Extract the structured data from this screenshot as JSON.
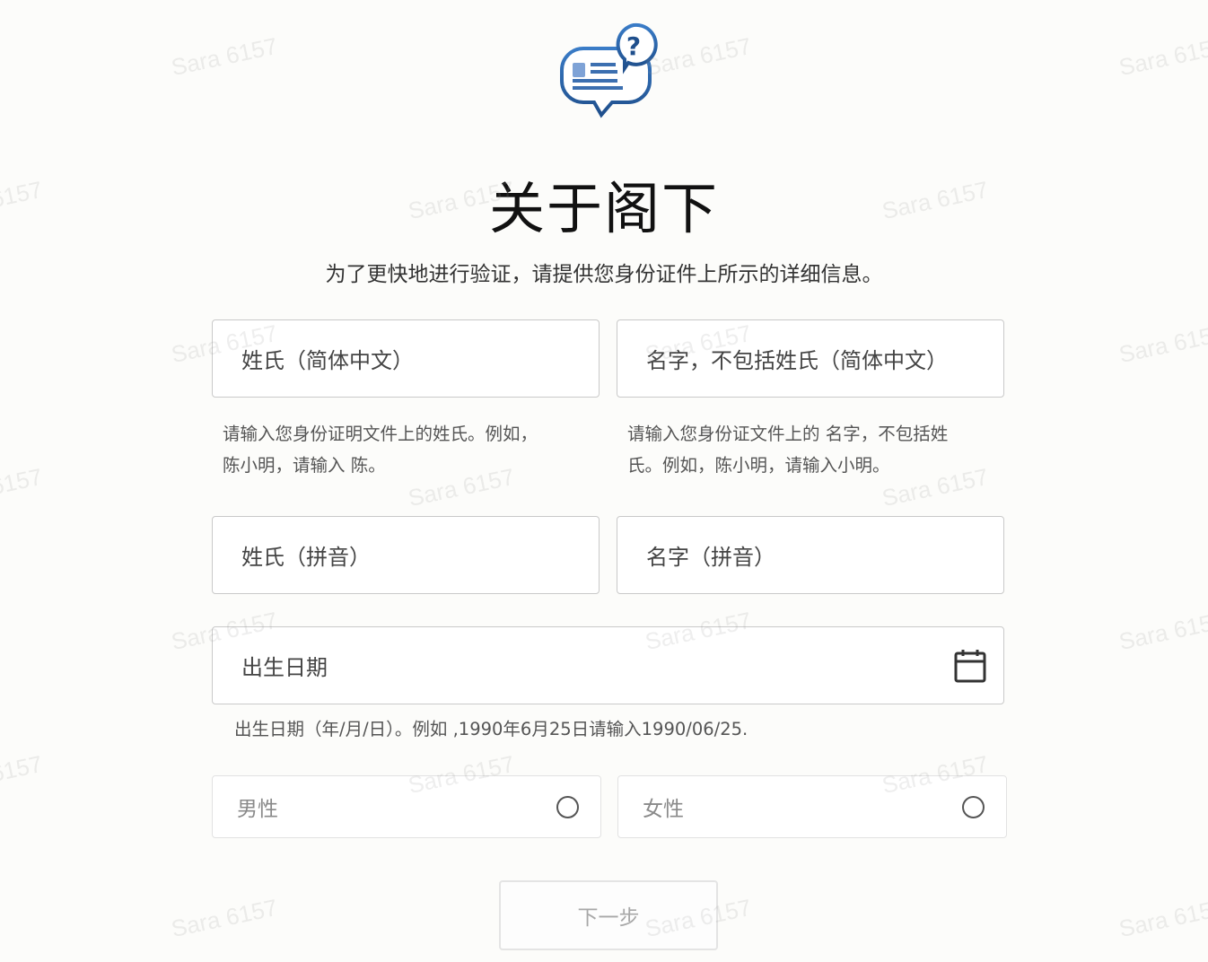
{
  "header": {
    "logo_icon": "id-document-question-chat-icon",
    "title": "关于阁下",
    "subtitle": "为了更快地进行验证，请提供您身份证件上所示的详细信息。"
  },
  "form": {
    "surname_cn": {
      "placeholder": "姓氏（简体中文）",
      "helper": [
        "请输入您身份证明文件上的姓氏。例如，",
        "陈小明，请输入 陈。"
      ]
    },
    "given_name_cn": {
      "placeholder": "名字，不包括姓氏（简体中文）",
      "helper": [
        "请输入您身份证文件上的 名字，不包括姓",
        "氏。例如，陈小明，请输入小明。"
      ]
    },
    "surname_pinyin": {
      "placeholder": "姓氏（拼音）"
    },
    "given_name_pinyin": {
      "placeholder": "名字（拼音）"
    },
    "birth_date": {
      "placeholder": "出生日期",
      "icon": "calendar-icon",
      "helper": "出生日期（年/月/日）。例如 ,1990年6月25日请输入1990/06/25."
    },
    "gender": {
      "options": [
        "男性",
        "女性"
      ],
      "selected": null
    },
    "next_button": "下一步",
    "next_enabled": false
  },
  "watermark": "Sara 6157",
  "colors": {
    "background": "#fcfcfa",
    "logo_blue": "#2e6cb5",
    "border": "#c9c9c9"
  }
}
